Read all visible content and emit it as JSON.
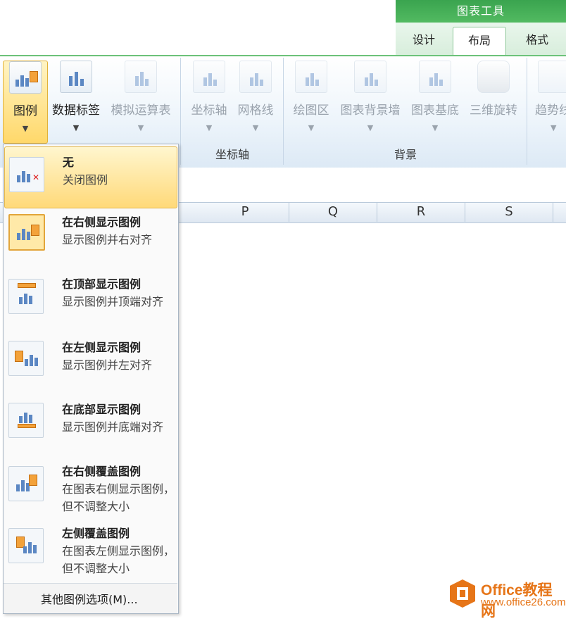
{
  "context_tab_group": "图表工具",
  "tabs": [
    {
      "label": "设计"
    },
    {
      "label": "布局"
    },
    {
      "label": "格式"
    }
  ],
  "ribbon": {
    "buttons": [
      {
        "label": "图例"
      },
      {
        "label": "数据标签"
      },
      {
        "label": "模拟运算表"
      },
      {
        "label": "坐标轴"
      },
      {
        "label": "网格线"
      },
      {
        "label": "绘图区"
      },
      {
        "label": "图表背景墙"
      },
      {
        "label": "图表基底"
      },
      {
        "label": "三维旋转"
      },
      {
        "label": "趋势线"
      }
    ],
    "groups": [
      {
        "label": "坐标轴"
      },
      {
        "label": "背景"
      }
    ]
  },
  "columns": [
    "P",
    "Q",
    "R",
    "S"
  ],
  "menu": {
    "items": [
      {
        "title": "无",
        "desc": "关闭图例"
      },
      {
        "title": "在右侧显示图例",
        "desc": "显示图例并右对齐"
      },
      {
        "title": "在顶部显示图例",
        "desc": "显示图例并顶端对齐"
      },
      {
        "title": "在左侧显示图例",
        "desc": "显示图例并左对齐"
      },
      {
        "title": "在底部显示图例",
        "desc": "显示图例并底端对齐"
      },
      {
        "title": "在右侧覆盖图例",
        "desc": "在图表右侧显示图例，但不调整大小"
      },
      {
        "title": "左侧覆盖图例",
        "desc": "在图表左侧显示图例，但不调整大小"
      }
    ],
    "more_options": "其他图例选项(M)..."
  },
  "watermark": {
    "title": "Office教程网",
    "url": "www.office26.com"
  },
  "colors": {
    "accent_green": "#4cae5c",
    "highlight": "#ffd86a",
    "brand_orange": "#e67518"
  }
}
